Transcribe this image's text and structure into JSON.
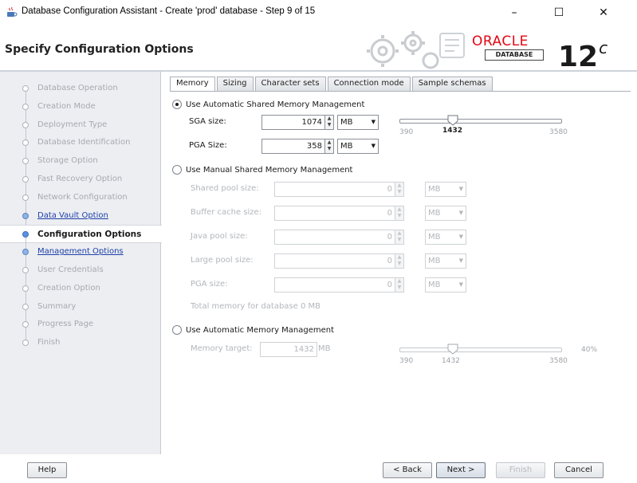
{
  "window": {
    "title": "Database Configuration Assistant - Create 'prod' database - Step 9 of 15",
    "min_glyph": "–",
    "max_glyph": "☐",
    "close_glyph": "✕",
    "icon": "java-cup-icon"
  },
  "header": {
    "title": "Specify Configuration Options",
    "brand": "ORACLE",
    "brand_sub": "DATABASE",
    "version": "12",
    "version_sup": "c",
    "brand_color": "#e30613"
  },
  "sidebar": {
    "steps": [
      {
        "label": "Database Operation",
        "state": "done"
      },
      {
        "label": "Creation Mode",
        "state": "done"
      },
      {
        "label": "Deployment Type",
        "state": "done"
      },
      {
        "label": "Database Identification",
        "state": "done"
      },
      {
        "label": "Storage Option",
        "state": "done"
      },
      {
        "label": "Fast Recovery Option",
        "state": "done"
      },
      {
        "label": "Network Configuration",
        "state": "done"
      },
      {
        "label": "Data Vault Option",
        "state": "link"
      },
      {
        "label": "Configuration Options",
        "state": "active"
      },
      {
        "label": "Management Options",
        "state": "link"
      },
      {
        "label": "User Credentials",
        "state": "pending"
      },
      {
        "label": "Creation Option",
        "state": "pending"
      },
      {
        "label": "Summary",
        "state": "pending"
      },
      {
        "label": "Progress Page",
        "state": "pending"
      },
      {
        "label": "Finish",
        "state": "pending"
      }
    ]
  },
  "tabs": [
    {
      "label": "Memory",
      "active": true
    },
    {
      "label": "Sizing",
      "active": false
    },
    {
      "label": "Character sets",
      "active": false
    },
    {
      "label": "Connection mode",
      "active": false
    },
    {
      "label": "Sample schemas",
      "active": false
    }
  ],
  "memory": {
    "asmm": {
      "label": "Use Automatic Shared Memory Management",
      "selected": true,
      "sga_label": "SGA size:",
      "sga_value": "1074",
      "sga_unit": "MB",
      "pga_label": "PGA Size:",
      "pga_value": "358",
      "pga_unit": "MB",
      "slider_min": "390",
      "slider_value": "1432",
      "slider_max": "3580",
      "slider_fraction": 0.33
    },
    "manual": {
      "label": "Use Manual Shared Memory Management",
      "selected": false,
      "rows": [
        {
          "label": "Shared pool size:",
          "value": "0",
          "unit": "MB"
        },
        {
          "label": "Buffer cache size:",
          "value": "0",
          "unit": "MB"
        },
        {
          "label": "Java pool size:",
          "value": "0",
          "unit": "MB"
        },
        {
          "label": "Large pool size:",
          "value": "0",
          "unit": "MB"
        },
        {
          "label": "PGA size:",
          "value": "0",
          "unit": "MB"
        }
      ],
      "total": "Total memory for database 0 MB"
    },
    "amm": {
      "label": "Use Automatic Memory Management",
      "selected": false,
      "target_label": "Memory target:",
      "target_value": "1432",
      "target_unit": "MB",
      "slider_min": "390",
      "slider_value": "1432",
      "slider_max": "3580",
      "percent": "40%",
      "slider_fraction": 0.33
    }
  },
  "buttons": {
    "help": "Help",
    "back": "< Back",
    "next": "Next >",
    "finish": "Finish",
    "cancel": "Cancel"
  }
}
